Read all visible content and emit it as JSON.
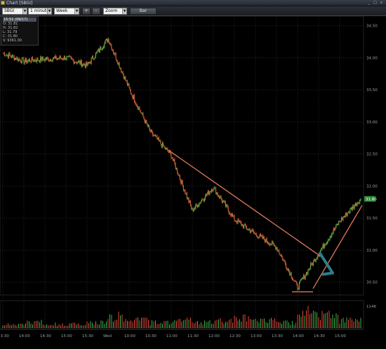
{
  "window": {
    "title": "Chart [SBGI]",
    "minimize": "_",
    "maximize": "□",
    "close": "x"
  },
  "toolbar": {
    "symbol": "SBGI",
    "interval": "1 minute",
    "range": "Week",
    "zoom_in": "+",
    "zoom_out": "-",
    "zoom": "Zoom",
    "chart_type": "Bar"
  },
  "info": {
    "time": "15:51 (09/17)",
    "open": "O: 31.81",
    "high": "H: 31.82",
    "low": "L: 31.79",
    "close": "C: 31.80",
    "volume": "V: 9361.00"
  },
  "price_axis": [
    "34.50",
    "34.00",
    "33.50",
    "33.00",
    "32.50",
    "32.00",
    "31.50",
    "31.00",
    "30.50"
  ],
  "last_price": "31.80",
  "volume_axis": "114K",
  "time_axis": [
    "13:30",
    "14:00",
    "14:30",
    "15:00",
    "15:30",
    "Wed",
    "10:00",
    "10:30",
    "11:00",
    "11:30",
    "12:00",
    "12:30",
    "13:00",
    "13:30",
    "14:00",
    "14:30",
    "15:00"
  ],
  "colors": {
    "up": "#3fb24b",
    "down": "#e04a3a",
    "trendline": "#e07a5a",
    "arrow": "#2a7f8a",
    "last_tag": "#2e8b3a"
  },
  "chart_data": {
    "type": "line",
    "title": "Chart [SBGI]",
    "xlabel": "",
    "ylabel": "",
    "ylim": [
      30.3,
      34.65
    ],
    "x": [
      "13:30",
      "14:00",
      "14:30",
      "15:00",
      "15:30",
      "Wed",
      "10:00",
      "10:30",
      "11:00",
      "11:30",
      "12:00",
      "12:30",
      "13:00",
      "13:30",
      "14:00",
      "14:30",
      "15:00",
      "15:50"
    ],
    "series": [
      {
        "values": [
          34.07,
          33.95,
          33.98,
          34.0,
          33.88,
          34.3,
          33.52,
          32.85,
          32.48,
          31.62,
          31.98,
          31.48,
          31.25,
          31.05,
          30.42,
          30.95,
          31.45,
          31.8
        ]
      }
    ],
    "volume": [
      2,
      3,
      2,
      2,
      3,
      6,
      4,
      3,
      4,
      3,
      4,
      5,
      4,
      3,
      8,
      7,
      4,
      5
    ]
  }
}
